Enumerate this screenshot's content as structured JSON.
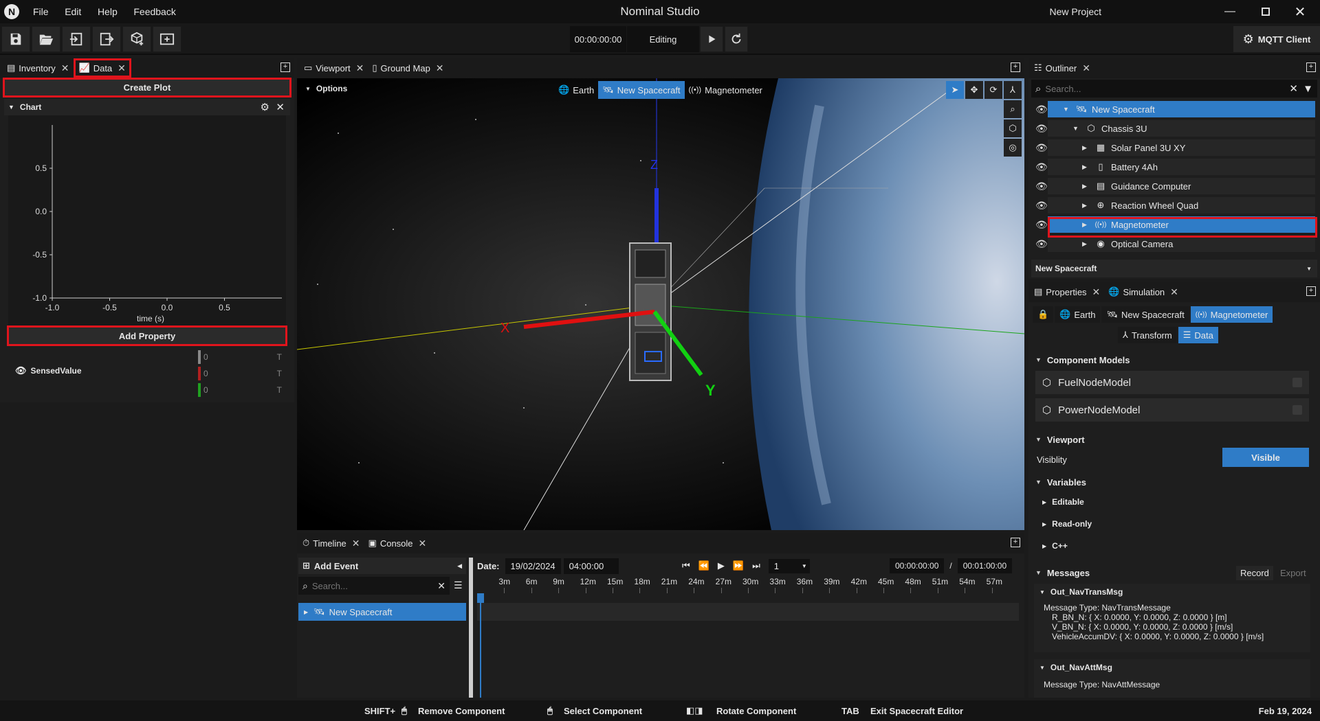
{
  "app": {
    "logo_letter": "N",
    "title": "Nominal Studio",
    "project": "New Project",
    "menu": [
      "File",
      "Edit",
      "Help",
      "Feedback"
    ]
  },
  "toolbar": {
    "timecode": "00:00:00:00",
    "mode": "Editing",
    "mqtt_label": "MQTT Client"
  },
  "left_panel": {
    "tabs": [
      "Inventory",
      "Data"
    ],
    "create_plot": "Create Plot",
    "chart_title": "Chart",
    "chart_data": {
      "type": "line",
      "xlabel": "time (s)",
      "ylabel": "",
      "xlim": [
        -1.0,
        1.0
      ],
      "ylim": [
        -1.0,
        1.0
      ],
      "x_ticks": [
        "-1.0",
        "-0.5",
        "0.0",
        "0.5"
      ],
      "y_ticks": [
        "0.5",
        "0.0",
        "-0.5",
        "-1.0"
      ],
      "series": []
    },
    "add_property": "Add Property",
    "property_name": "SensedValue",
    "property_rows": [
      {
        "value": "0",
        "flag": "T",
        "color": "#888888"
      },
      {
        "value": "0",
        "flag": "T",
        "color": "#b02020"
      },
      {
        "value": "0",
        "flag": "T",
        "color": "#20a020"
      }
    ]
  },
  "viewport": {
    "tabs": [
      "Viewport",
      "Ground Map"
    ],
    "options_label": "Options",
    "context": [
      "Earth",
      "New Spacecraft",
      "Magnetometer"
    ],
    "axis_labels": {
      "x": "X",
      "y": "Y",
      "z": "Z"
    }
  },
  "timeline": {
    "tabs": [
      "Timeline",
      "Console"
    ],
    "add_event": "Add Event",
    "search_placeholder": "Search...",
    "tree_item": "New Spacecraft",
    "date_label": "Date:",
    "date": "19/02/2024",
    "time": "04:00:00",
    "speed": "1",
    "current": "00:00:00:00",
    "separator": "/",
    "total": "00:01:00:00",
    "ticks": [
      "3m",
      "6m",
      "9m",
      "12m",
      "15m",
      "18m",
      "21m",
      "24m",
      "27m",
      "30m",
      "33m",
      "36m",
      "39m",
      "42m",
      "45m",
      "48m",
      "51m",
      "54m",
      "57m"
    ]
  },
  "outliner": {
    "tab": "Outliner",
    "search_placeholder": "Search...",
    "items": [
      {
        "label": "New Spacecraft",
        "icon": "satellite-icon",
        "glyph": "🛰",
        "depth": 0,
        "selected": true,
        "expanded": true
      },
      {
        "label": "Chassis 3U",
        "icon": "cube-icon",
        "glyph": "⬡",
        "depth": 1,
        "selected": false,
        "expanded": true
      },
      {
        "label": "Solar Panel 3U XY",
        "icon": "solar-panel-icon",
        "glyph": "▦",
        "depth": 2,
        "selected": false,
        "expanded": false
      },
      {
        "label": "Battery 4Ah",
        "icon": "battery-icon",
        "glyph": "▯",
        "depth": 2,
        "selected": false,
        "expanded": false
      },
      {
        "label": "Guidance Computer",
        "icon": "computer-chip-icon",
        "glyph": "▤",
        "depth": 2,
        "selected": false,
        "expanded": false
      },
      {
        "label": "Reaction Wheel Quad",
        "icon": "reaction-wheel-icon",
        "glyph": "⊕",
        "depth": 2,
        "selected": false,
        "expanded": false
      },
      {
        "label": "Magnetometer",
        "icon": "magnetometer-icon",
        "glyph": "((•))",
        "depth": 2,
        "selected": true,
        "expanded": false
      },
      {
        "label": "Optical Camera",
        "icon": "camera-icon",
        "glyph": "◉",
        "depth": 2,
        "selected": false,
        "expanded": false
      }
    ],
    "scene_selector": "New Spacecraft"
  },
  "properties": {
    "tabs": [
      "Properties",
      "Simulation"
    ],
    "crumbs": [
      "Earth",
      "New Spacecraft",
      "Magnetometer"
    ],
    "subtabs": [
      "Transform",
      "Data"
    ],
    "component_models_title": "Component Models",
    "models": [
      "FuelNodeModel",
      "PowerNodeModel"
    ],
    "viewport_title": "Viewport",
    "visibility_label": "Visiblity",
    "visibility_value": "Visible",
    "variables_title": "Variables",
    "variable_groups": [
      "Editable",
      "Read-only",
      "C++"
    ],
    "messages_title": "Messages",
    "record_label": "Record",
    "export_label": "Export",
    "msg1_name": "Out_NavTransMsg",
    "msg1_type": "Message Type: NavTransMessage",
    "msg1_lines": [
      "R_BN_N:  { X: 0.0000, Y: 0.0000, Z: 0.0000 }  [m]",
      "V_BN_N:  { X: 0.0000, Y: 0.0000, Z: 0.0000 }  [m/s]",
      "VehicleAccumDV:  { X: 0.0000, Y: 0.0000, Z: 0.0000 }  [m/s]"
    ],
    "msg2_name": "Out_NavAttMsg",
    "msg2_type": "Message Type: NavAttMessage"
  },
  "statusbar": {
    "shift": "SHIFT+",
    "remove": "Remove Component",
    "select": "Select Component",
    "rotate": "Rotate Component",
    "tab_key": "TAB",
    "exit": "Exit Spacecraft Editor",
    "date": "Feb 19, 2024"
  }
}
